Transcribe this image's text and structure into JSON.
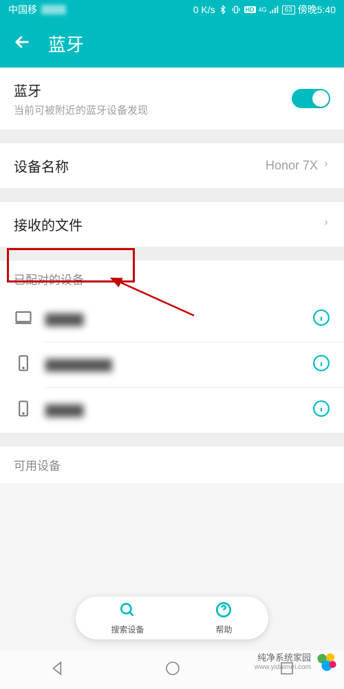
{
  "status": {
    "carrier": "中国移",
    "speed": "0 K/s",
    "network_badge": "HD",
    "signal_badge": "4G",
    "battery": "63",
    "time": "傍晚5:40"
  },
  "header": {
    "title": "蓝牙"
  },
  "bluetooth": {
    "title": "蓝牙",
    "subtitle": "当前可被附近的蓝牙设备发现",
    "enabled": true
  },
  "device_name_row": {
    "label": "设备名称",
    "value": "Honor 7X"
  },
  "received_files": {
    "label": "接收的文件"
  },
  "sections": {
    "paired": "已配对的设备",
    "available": "可用设备"
  },
  "paired_devices": [
    {
      "kind": "laptop",
      "name": "▇▇▇▇"
    },
    {
      "kind": "phone",
      "name": "▇▇▇▇▇▇▇"
    },
    {
      "kind": "phone",
      "name": "▇▇▇▇"
    }
  ],
  "bottom_actions": {
    "search": "搜索设备",
    "help": "帮助"
  },
  "watermark": {
    "line1": "纯净系统家园",
    "line2": "www.yidaimei.com"
  }
}
